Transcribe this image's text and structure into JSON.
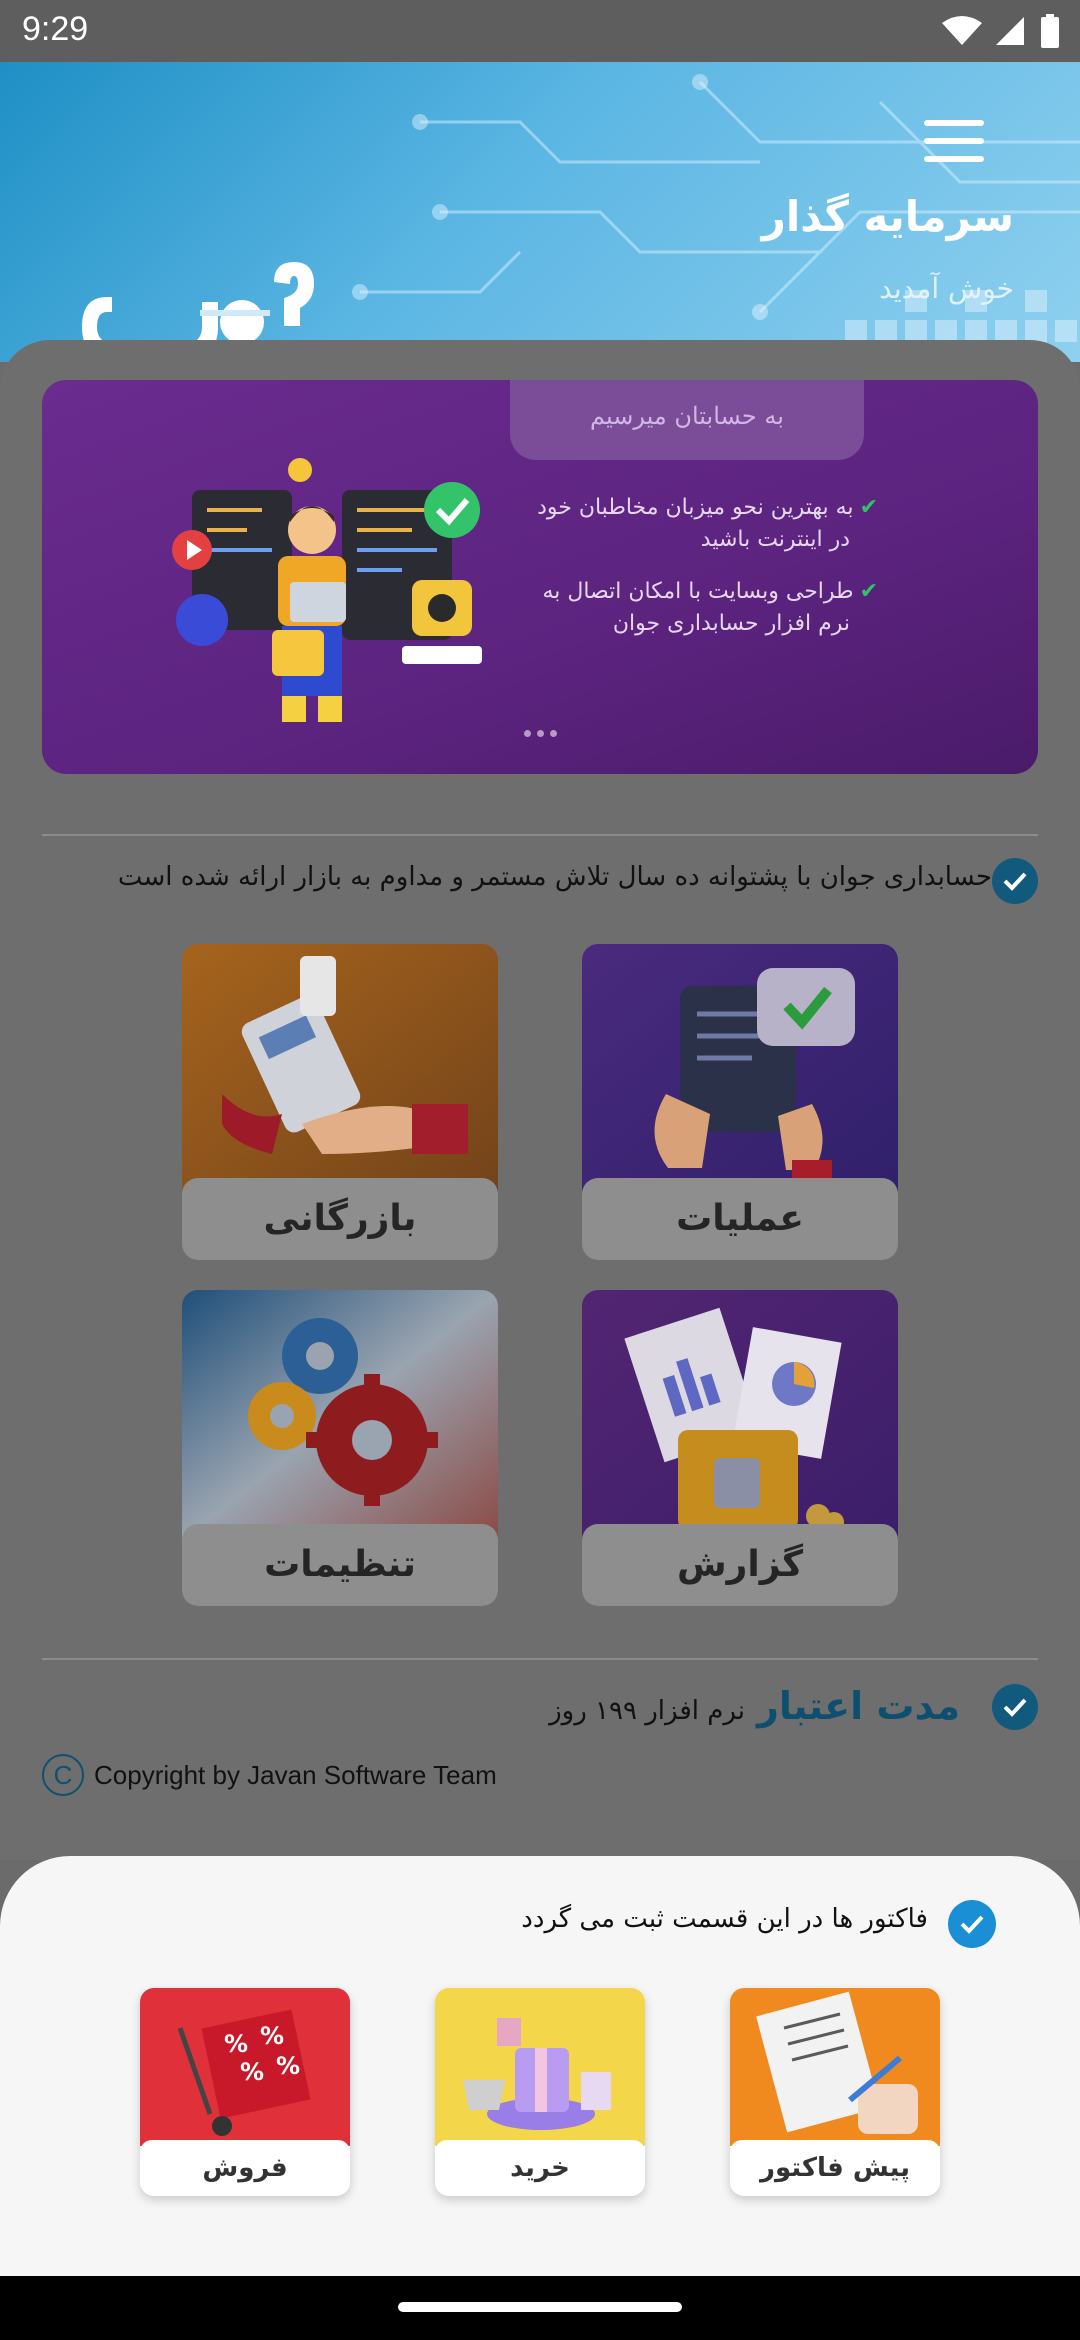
{
  "status_bar": {
    "time": "9:29"
  },
  "header": {
    "title": "سرمایه گذار",
    "subtitle": "خوش آمدید",
    "logo_text": "جوان"
  },
  "banner": {
    "tab_text": "به حسابتان میرسیم",
    "bullets": [
      "به بهترین نحو میزبان مخاطبان خود",
      "در اینترنت باشید",
      "طراحی وبسایت با امکان اتصال به",
      "نرم افزار حسابداری جوان"
    ],
    "page_count": 3
  },
  "info": {
    "text": "حسابداری جوان با پشتوانه ده سال تلاش مستمر و مداوم به بازار ارائه شده است"
  },
  "tiles": [
    {
      "label": "عملیات"
    },
    {
      "label": "بازرگانی"
    },
    {
      "label": "گزارش"
    },
    {
      "label": "تنظیمات"
    }
  ],
  "validity": {
    "title": "مدت اعتبار",
    "text": "نرم افزار ۱۹۹ روز"
  },
  "copyright": {
    "symbol": "C",
    "text": "Copyright by Javan Software Team"
  },
  "bottom_sheet": {
    "header_text": "فاکتور ها در این قسمت ثبت می گردد",
    "tiles": [
      {
        "label": "پیش فاکتور"
      },
      {
        "label": "خرید"
      },
      {
        "label": "فروش"
      }
    ]
  },
  "colors": {
    "header_blue": "#1e8fc5",
    "check_blue": "#1a8fd6",
    "validity_title": "#0e4f70",
    "banner_purple": "#5c237f"
  }
}
